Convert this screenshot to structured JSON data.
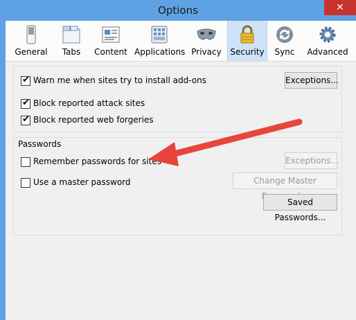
{
  "window": {
    "title": "Options",
    "close_label": "✕"
  },
  "tabs": [
    {
      "label": "General"
    },
    {
      "label": "Tabs"
    },
    {
      "label": "Content"
    },
    {
      "label": "Applications"
    },
    {
      "label": "Privacy"
    },
    {
      "label": "Security"
    },
    {
      "label": "Sync"
    },
    {
      "label": "Advanced"
    }
  ],
  "selected_tab": "Security",
  "general_group": {
    "warn_addons": {
      "label": "Warn me when sites try to install add-ons",
      "checked": true
    },
    "exceptions_label": "Exceptions...",
    "block_attack": {
      "label": "Block reported attack sites",
      "checked": true
    },
    "block_forgeries": {
      "label": "Block reported web forgeries",
      "checked": true
    }
  },
  "passwords": {
    "section_title": "Passwords",
    "remember": {
      "label": "Remember passwords for sites",
      "checked": false
    },
    "exceptions_label": "Exceptions...",
    "master": {
      "label": "Use a master password",
      "checked": false
    },
    "change_master_label": "Change Master Password...",
    "saved_label": "Saved Passwords..."
  },
  "colors": {
    "title_bar": "#5fa2e3",
    "close_button": "#c7332c",
    "arrow": "#e8453c",
    "selected_tab_bg": "#cfe3f8"
  }
}
